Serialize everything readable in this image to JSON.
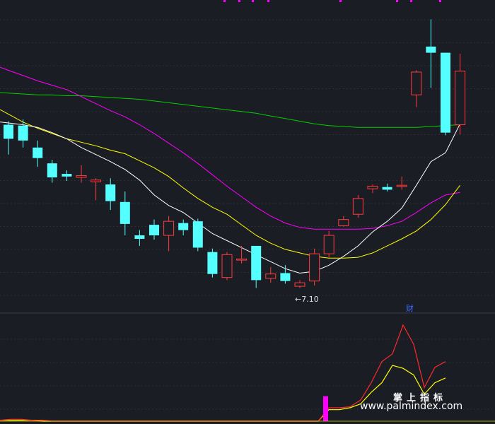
{
  "chart_data": {
    "type": "candlestick",
    "annotations": {
      "low_label": "←7.10",
      "finance_marker": "财"
    },
    "watermark": {
      "cn": "掌上指标",
      "url": "www.palmindex.com"
    },
    "colors": {
      "up": "#ff3c3c",
      "down": "#54ffff",
      "ma_short": "#ffffff",
      "ma_mid": "#ffff00",
      "ma_long": "#ff00ff",
      "ma_xlong": "#00d000",
      "indicator_red": "#ff2a2a",
      "indicator_yellow": "#ffff00",
      "indicator_bar": "#ff00ff"
    },
    "candles": [
      {
        "o": 8.96,
        "h": 9.0,
        "l": 8.62,
        "c": 8.8
      },
      {
        "o": 8.95,
        "h": 9.02,
        "l": 8.7,
        "c": 8.78
      },
      {
        "o": 8.7,
        "h": 8.78,
        "l": 8.48,
        "c": 8.58
      },
      {
        "o": 8.52,
        "h": 8.56,
        "l": 8.3,
        "c": 8.36
      },
      {
        "o": 8.4,
        "h": 8.44,
        "l": 8.32,
        "c": 8.37
      },
      {
        "o": 8.36,
        "h": 8.5,
        "l": 8.3,
        "c": 8.38
      },
      {
        "o": 8.31,
        "h": 8.35,
        "l": 8.1,
        "c": 8.33
      },
      {
        "o": 8.28,
        "h": 8.35,
        "l": 7.99,
        "c": 8.09
      },
      {
        "o": 8.08,
        "h": 8.2,
        "l": 7.7,
        "c": 7.83
      },
      {
        "o": 7.7,
        "h": 7.76,
        "l": 7.58,
        "c": 7.66
      },
      {
        "o": 7.82,
        "h": 7.88,
        "l": 7.65,
        "c": 7.7
      },
      {
        "o": 7.7,
        "h": 7.92,
        "l": 7.52,
        "c": 7.86
      },
      {
        "o": 7.84,
        "h": 7.88,
        "l": 7.7,
        "c": 7.76
      },
      {
        "o": 7.86,
        "h": 7.89,
        "l": 7.52,
        "c": 7.56
      },
      {
        "o": 7.51,
        "h": 7.55,
        "l": 7.22,
        "c": 7.26
      },
      {
        "o": 7.22,
        "h": 7.51,
        "l": 7.19,
        "c": 7.48
      },
      {
        "o": 7.42,
        "h": 7.58,
        "l": 7.38,
        "c": 7.43
      },
      {
        "o": 7.58,
        "h": 7.58,
        "l": 7.1,
        "c": 7.19
      },
      {
        "o": 7.21,
        "h": 7.34,
        "l": 7.16,
        "c": 7.26
      },
      {
        "o": 7.27,
        "h": 7.36,
        "l": 7.15,
        "c": 7.18
      },
      {
        "o": 7.12,
        "h": 7.19,
        "l": 7.1,
        "c": 7.16
      },
      {
        "o": 7.18,
        "h": 7.55,
        "l": 7.13,
        "c": 7.49
      },
      {
        "o": 7.49,
        "h": 7.75,
        "l": 7.45,
        "c": 7.7
      },
      {
        "o": 7.81,
        "h": 7.92,
        "l": 7.8,
        "c": 7.88
      },
      {
        "o": 7.94,
        "h": 8.16,
        "l": 7.9,
        "c": 8.12
      },
      {
        "o": 8.23,
        "h": 8.28,
        "l": 8.18,
        "c": 8.26
      },
      {
        "o": 8.25,
        "h": 8.29,
        "l": 8.2,
        "c": 8.22
      },
      {
        "o": 8.27,
        "h": 8.37,
        "l": 8.22,
        "c": 8.27
      },
      {
        "o": 9.3,
        "h": 9.58,
        "l": 9.16,
        "c": 9.56
      },
      {
        "o": 9.85,
        "h": 10.16,
        "l": 9.38,
        "c": 9.78
      },
      {
        "o": 9.78,
        "h": 9.78,
        "l": 8.84,
        "c": 8.87
      },
      {
        "o": 8.96,
        "h": 9.77,
        "l": 8.85,
        "c": 9.57
      }
    ],
    "ma_short": [
      8.98,
      8.96,
      8.93,
      8.87,
      8.8,
      8.7,
      8.62,
      8.54,
      8.45,
      8.33,
      8.16,
      8.04,
      7.96,
      7.84,
      7.72,
      7.64,
      7.56,
      7.48,
      7.4,
      7.32,
      7.27,
      7.29,
      7.36,
      7.46,
      7.58,
      7.74,
      7.86,
      8.01,
      8.27,
      8.54,
      8.64,
      8.97
    ],
    "ma_mid": [
      9.08,
      8.99,
      8.92,
      8.86,
      8.8,
      8.76,
      8.72,
      8.67,
      8.63,
      8.55,
      8.47,
      8.37,
      8.24,
      8.12,
      8.02,
      7.94,
      7.82,
      7.7,
      7.61,
      7.54,
      7.5,
      7.46,
      7.44,
      7.44,
      7.45,
      7.5,
      7.58,
      7.66,
      7.75,
      7.88,
      8.05,
      8.27
    ],
    "ma_long": [
      9.58,
      9.52,
      9.46,
      9.41,
      9.36,
      9.28,
      9.2,
      9.12,
      9.05,
      8.96,
      8.86,
      8.75,
      8.64,
      8.52,
      8.39,
      8.26,
      8.14,
      8.02,
      7.92,
      7.84,
      7.79,
      7.77,
      7.77,
      7.77,
      7.77,
      7.78,
      7.81,
      7.86,
      7.96,
      8.07,
      8.16,
      8.19
    ],
    "ma_xlong": [
      9.32,
      9.31,
      9.3,
      9.3,
      9.29,
      9.29,
      9.28,
      9.27,
      9.26,
      9.25,
      9.23,
      9.21,
      9.19,
      9.17,
      9.15,
      9.13,
      9.11,
      9.09,
      9.06,
      9.03,
      9.0,
      8.97,
      8.95,
      8.94,
      8.93,
      8.93,
      8.93,
      8.93,
      8.93,
      8.94,
      8.95,
      8.96
    ],
    "y_range": [
      7.0,
      10.3
    ],
    "indicator": {
      "red_line": [
        1,
        2,
        2,
        1,
        1,
        0,
        0,
        0,
        0,
        0,
        0,
        0,
        0,
        0,
        0,
        0,
        0,
        0,
        0,
        0,
        0,
        0,
        0,
        0,
        0,
        0,
        0,
        0,
        0,
        0,
        0,
        14,
        14,
        15,
        22,
        40,
        62,
        70,
        100,
        80,
        35,
        56,
        62
      ],
      "yellow_line": [
        1,
        1,
        1,
        1,
        0,
        0,
        0,
        0,
        0,
        0,
        0,
        0,
        0,
        0,
        0,
        0,
        0,
        0,
        0,
        0,
        0,
        0,
        0,
        0,
        0,
        0,
        0,
        0,
        0,
        0,
        0,
        12,
        12,
        14,
        18,
        30,
        40,
        58,
        55,
        48,
        28,
        40,
        45
      ],
      "bar_value": 26,
      "range": [
        0,
        100
      ]
    }
  }
}
